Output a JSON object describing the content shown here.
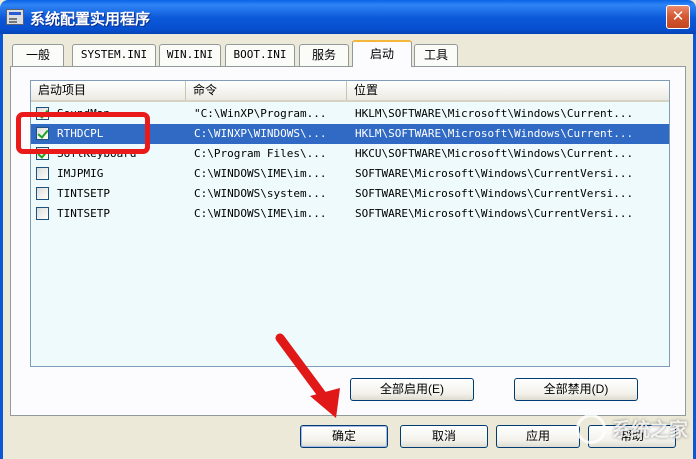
{
  "window": {
    "title": "系统配置实用程序",
    "close_label": "✕"
  },
  "tabs": [
    {
      "label": "一般"
    },
    {
      "label": "SYSTEM.INI"
    },
    {
      "label": "WIN.INI"
    },
    {
      "label": "BOOT.INI"
    },
    {
      "label": "服务"
    },
    {
      "label": "启动",
      "active": true
    },
    {
      "label": "工具"
    }
  ],
  "startup_list": {
    "columns": [
      "启动项目",
      "命令",
      "位置"
    ],
    "rows": [
      {
        "checked": true,
        "item": "SoundMan",
        "command": "\"C:\\WinXP\\Program...",
        "location": "HKLM\\SOFTWARE\\Microsoft\\Windows\\Current..."
      },
      {
        "checked": true,
        "item": "RTHDCPL",
        "command": "C:\\WINXP\\WINDOWS\\...",
        "location": "HKLM\\SOFTWARE\\Microsoft\\Windows\\Current...",
        "selected": true
      },
      {
        "checked": true,
        "item": "SoftKeyboard",
        "command": "C:\\Program Files\\...",
        "location": "HKCU\\SOFTWARE\\Microsoft\\Windows\\Current..."
      },
      {
        "checked": false,
        "item": "IMJPMIG",
        "command": "C:\\WINDOWS\\IME\\im...",
        "location": "SOFTWARE\\Microsoft\\Windows\\CurrentVersi..."
      },
      {
        "checked": false,
        "item": "TINTSETP",
        "command": "C:\\WINDOWS\\system...",
        "location": "SOFTWARE\\Microsoft\\Windows\\CurrentVersi..."
      },
      {
        "checked": false,
        "item": "TINTSETP",
        "command": "C:\\WINDOWS\\IME\\im...",
        "location": "SOFTWARE\\Microsoft\\Windows\\CurrentVersi..."
      }
    ]
  },
  "buttons": {
    "enable_all": "全部启用(E)",
    "disable_all": "全部禁用(D)",
    "ok": "确定",
    "cancel": "取消",
    "apply": "应用",
    "help": "帮助"
  },
  "watermark": {
    "text": "系统之家"
  },
  "colors": {
    "titlebar": "#0a57d8",
    "selection": "#316ac5",
    "highlight": "#ea1a1a",
    "list_background": "#eefafb"
  }
}
